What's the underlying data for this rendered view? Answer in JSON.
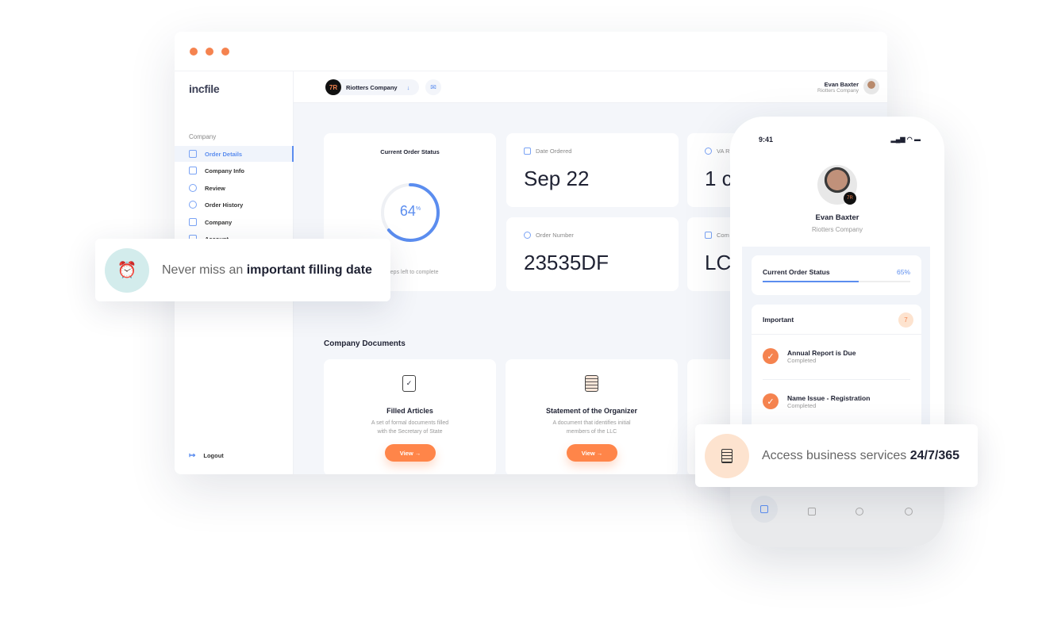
{
  "colors": {
    "accent": "#F5834F",
    "primary": "#5B8DEF",
    "background": "#F4F6FA"
  },
  "app": {
    "logo_pre": "inc",
    "logo_post": "file"
  },
  "sidebar": {
    "section": "Company",
    "items": [
      {
        "label": "Order Details",
        "icon": "clipboard-icon",
        "active": true
      },
      {
        "label": "Company Info",
        "icon": "layout-icon"
      },
      {
        "label": "Review",
        "icon": "check-circle-icon"
      },
      {
        "label": "Order History",
        "icon": "clock-icon"
      },
      {
        "label": "Company",
        "icon": "briefcase-icon"
      },
      {
        "label": "Account",
        "icon": "user-icon"
      }
    ],
    "logout": "Logout"
  },
  "header": {
    "company": "Riotters Company",
    "company_logo": "7R",
    "user_name": "Evan Baxter",
    "user_company": "Riotters Company"
  },
  "status_card": {
    "title": "Current Order Status",
    "percent": 64,
    "percent_label": "64",
    "percent_sign": "%",
    "footer": "2 steps left to complete"
  },
  "date_card": {
    "label": "Date Ordered",
    "value": "Sep 22"
  },
  "order_card": {
    "label": "Order Number",
    "value": "23535DF"
  },
  "va_card": {
    "label": "VA R",
    "value": "1 c"
  },
  "company_card": {
    "label": "Com",
    "value": "LC"
  },
  "documents": {
    "title": "Company Documents",
    "items": [
      {
        "title": "Filled Articles",
        "desc1": "A set of formal documents filled",
        "desc2": "with the Secretary of State",
        "button": "View"
      },
      {
        "title": "Statement of the Organizer",
        "desc1": "A document that identifies initial",
        "desc2": "members of the LLC",
        "button": "View"
      }
    ]
  },
  "phone": {
    "time": "9:41",
    "name": "Evan Baxter",
    "company": "Riotters Company",
    "status": {
      "title": "Current Order Status",
      "percent": 65,
      "percent_label": "65%"
    },
    "important": {
      "title": "Important",
      "count": "7",
      "items": [
        {
          "title": "Annual Report is Due",
          "status": "Completed"
        },
        {
          "title": "Name Issue - Registration",
          "status": "Completed"
        }
      ]
    },
    "nav": [
      "layout-icon",
      "clipboard-icon",
      "clock-icon",
      "check-circle-icon"
    ]
  },
  "toasts": {
    "first": {
      "pre": "Never miss an ",
      "bold": "important filling date"
    },
    "second": {
      "pre": "Access business services ",
      "bold": "24/7/365"
    }
  }
}
